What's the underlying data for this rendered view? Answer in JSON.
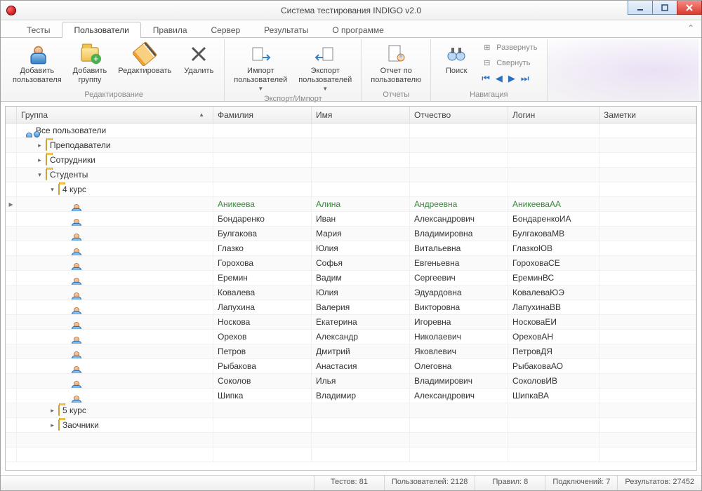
{
  "window": {
    "title": "Система тестирования INDIGO v2.0"
  },
  "tabs": {
    "items": [
      "Тесты",
      "Пользователи",
      "Правила",
      "Сервер",
      "Результаты",
      "О программе"
    ],
    "active_index": 1
  },
  "ribbon": {
    "groups": [
      {
        "label": "Редактирование",
        "buttons": [
          {
            "name": "add-user",
            "label": "Добавить\nпользователя"
          },
          {
            "name": "add-group",
            "label": "Добавить\nгруппу"
          },
          {
            "name": "edit",
            "label": "Редактировать"
          },
          {
            "name": "delete",
            "label": "Удалить"
          }
        ]
      },
      {
        "label": "Экспорт/Импорт",
        "buttons": [
          {
            "name": "import",
            "label": "Импорт\nпользователей",
            "dropdown": true
          },
          {
            "name": "export",
            "label": "Экспорт\nпользователей",
            "dropdown": true
          }
        ]
      },
      {
        "label": "Отчеты",
        "buttons": [
          {
            "name": "report",
            "label": "Отчет по\nпользователю"
          }
        ]
      },
      {
        "label": "Навигация",
        "buttons": [
          {
            "name": "search",
            "label": "Поиск"
          }
        ],
        "small_buttons": [
          {
            "name": "expand",
            "label": "Развернуть"
          },
          {
            "name": "collapse",
            "label": "Свернуть"
          }
        ],
        "nav_arrows": [
          "⏮",
          "◀",
          "▶",
          "⏭"
        ]
      }
    ]
  },
  "grid": {
    "columns": [
      "Группа",
      "Фамилия",
      "Имя",
      "Отчество",
      "Логин",
      "Заметки"
    ],
    "root": {
      "label": "Все пользователи"
    },
    "tree_groups": [
      {
        "label": "Преподаватели",
        "expanded": false
      },
      {
        "label": "Сотрудники",
        "expanded": false
      },
      {
        "label": "Студенты",
        "expanded": true,
        "children": [
          {
            "label": "4 курс",
            "expanded": true
          },
          {
            "label": "5 курс",
            "expanded": false
          },
          {
            "label": "Заочники",
            "expanded": false
          }
        ]
      }
    ],
    "students": [
      {
        "surname": "Аникеева",
        "name": "Алина",
        "patronymic": "Андреевна",
        "login": "АникееваАА",
        "selected": true
      },
      {
        "surname": "Бондаренко",
        "name": "Иван",
        "patronymic": "Александрович",
        "login": "БондаренкоИА"
      },
      {
        "surname": "Булгакова",
        "name": "Мария",
        "patronymic": "Владимировна",
        "login": "БулгаковаМВ"
      },
      {
        "surname": "Глазко",
        "name": "Юлия",
        "patronymic": "Витальевна",
        "login": "ГлазкоЮВ"
      },
      {
        "surname": "Горохова",
        "name": "Софья",
        "patronymic": "Евгеньевна",
        "login": "ГороховаСЕ"
      },
      {
        "surname": "Еремин",
        "name": "Вадим",
        "patronymic": "Сергеевич",
        "login": "ЕреминВС"
      },
      {
        "surname": "Ковалева",
        "name": "Юлия",
        "patronymic": "Эдуардовна",
        "login": "КовалеваЮЭ"
      },
      {
        "surname": "Лапухина",
        "name": "Валерия",
        "patronymic": "Викторовна",
        "login": "ЛапухинаВВ"
      },
      {
        "surname": "Носкова",
        "name": "Екатерина",
        "patronymic": "Игоревна",
        "login": "НосковаЕИ"
      },
      {
        "surname": "Орехов",
        "name": "Александр",
        "patronymic": "Николаевич",
        "login": "ОреховАН"
      },
      {
        "surname": "Петров",
        "name": "Дмитрий",
        "patronymic": "Яковлевич",
        "login": "ПетровДЯ"
      },
      {
        "surname": "Рыбакова",
        "name": "Анастасия",
        "patronymic": "Олеговна",
        "login": "РыбаковаАО"
      },
      {
        "surname": "Соколов",
        "name": "Илья",
        "patronymic": "Владимирович",
        "login": "СоколовИВ"
      },
      {
        "surname": "Шипка",
        "name": "Владимир",
        "patronymic": "Александрович",
        "login": "ШипкаВА"
      }
    ]
  },
  "statusbar": {
    "tests_label": "Тестов:",
    "tests": 81,
    "users_label": "Пользователей:",
    "users": 2128,
    "rules_label": "Правил:",
    "rules": 8,
    "conns_label": "Подключений:",
    "conns": 7,
    "results_label": "Результатов:",
    "results": 27452
  }
}
